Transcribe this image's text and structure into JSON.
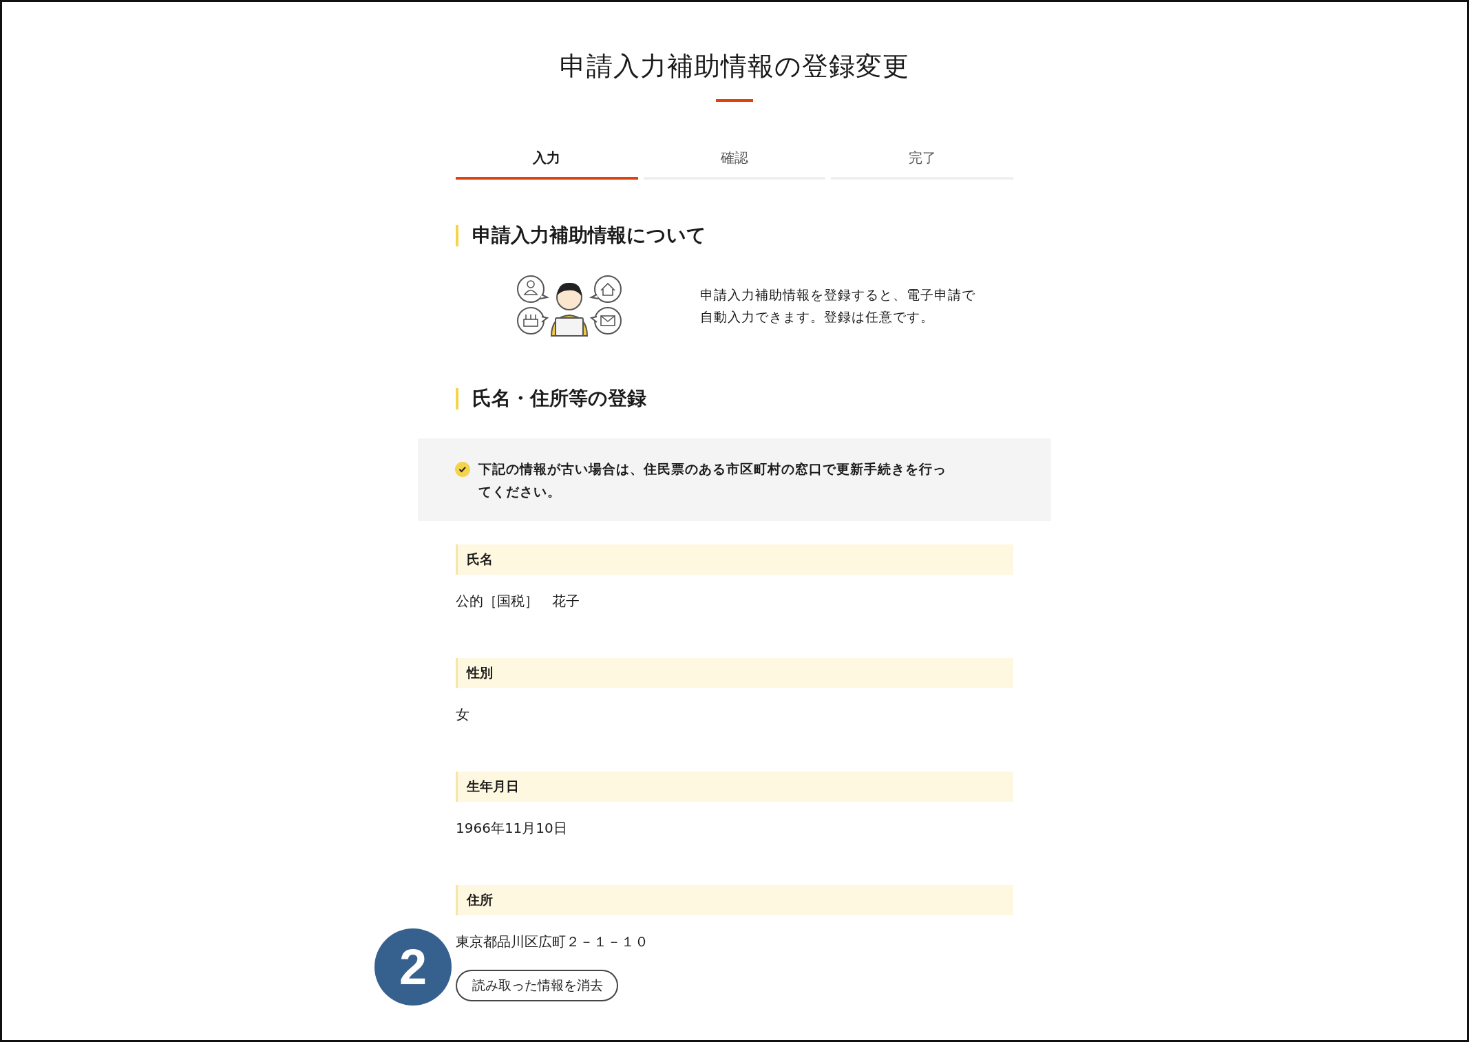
{
  "page": {
    "title": "申請入力補助情報の登録変更"
  },
  "steps": [
    {
      "label": "入力",
      "selected": true
    },
    {
      "label": "確認",
      "selected": false
    },
    {
      "label": "完了",
      "selected": false
    }
  ],
  "about": {
    "heading": "申請入力補助情報について",
    "description": "申請入力補助情報を登録すると、電子申請で自動入力できます。登録は任意です。"
  },
  "registration": {
    "heading": "氏名・住所等の登録",
    "notice": "下記の情報が古い場合は、住民票のある市区町村の窓口で更新手続きを行ってください。",
    "fields": [
      {
        "label": "氏名",
        "value": "公的［国税］　花子"
      },
      {
        "label": "性別",
        "value": "女"
      },
      {
        "label": "生年月日",
        "value": "1966年11月10日"
      },
      {
        "label": "住所",
        "value": "東京都品川区広町２－１－１０"
      }
    ],
    "clear_button": "読み取った情報を消去"
  },
  "callout": {
    "number": "2"
  }
}
